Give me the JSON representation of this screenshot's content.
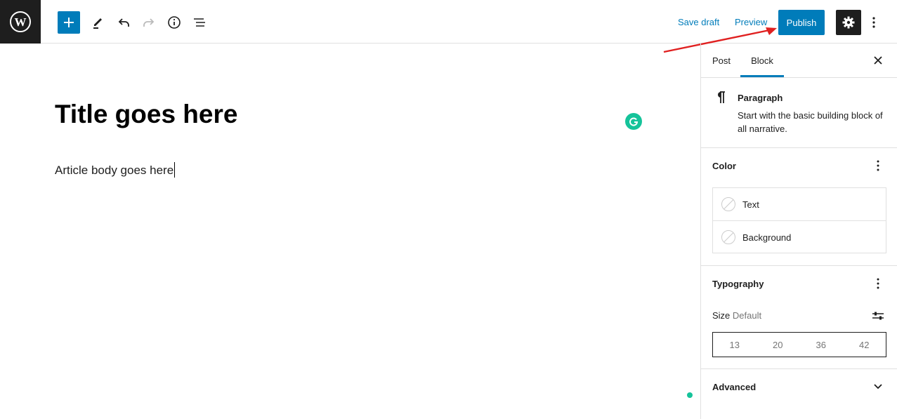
{
  "toolbar": {
    "save_draft": "Save draft",
    "preview": "Preview",
    "publish": "Publish"
  },
  "editor": {
    "title": "Title goes here",
    "body": "Article body goes here"
  },
  "sidebar": {
    "tabs": [
      {
        "label": "Post"
      },
      {
        "label": "Block"
      }
    ],
    "active_tab": "Block",
    "block": {
      "name": "Paragraph",
      "description": "Start with the basic building block of all narrative."
    },
    "color": {
      "title": "Color",
      "items": [
        {
          "label": "Text"
        },
        {
          "label": "Background"
        }
      ]
    },
    "typography": {
      "title": "Typography",
      "size_label": "Size",
      "size_value": "Default",
      "sizes": [
        "13",
        "20",
        "36",
        "42"
      ]
    },
    "advanced": {
      "title": "Advanced"
    }
  },
  "colors": {
    "accent": "#007cba",
    "dark": "#1e1e1e",
    "grammarly": "#15c39a",
    "annotation_arrow": "#e02020"
  }
}
